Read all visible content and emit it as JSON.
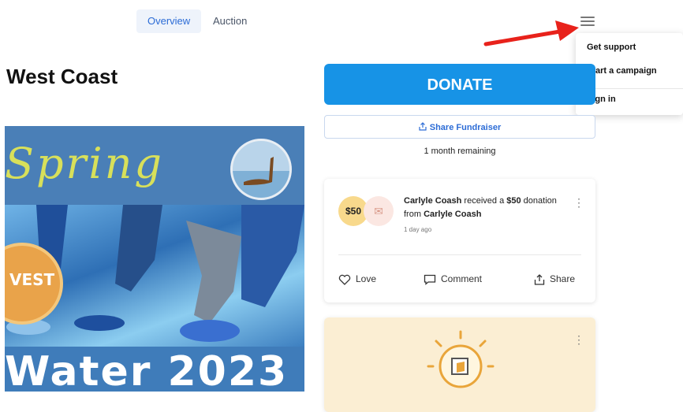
{
  "nav": {
    "tabs": [
      {
        "label": "Overview"
      },
      {
        "label": "Auction"
      }
    ]
  },
  "menu": {
    "items": [
      "Get support",
      "Start a campaign",
      "Sign in"
    ]
  },
  "campaign": {
    "title": "West Coast"
  },
  "poster": {
    "top_text": "Spring",
    "badge_text": "VEST",
    "bottom_text": "Water 2023"
  },
  "donate": {
    "label": "DONATE",
    "share_label": "Share Fundraiser",
    "remaining": "1 month remaining"
  },
  "activity": {
    "amount": "$50",
    "donor": "Carlyle Coash",
    "text_mid": " received a ",
    "amount_text": "$50",
    "text_after": " donation from ",
    "from": "Carlyle Coash",
    "time": "1 day ago",
    "actions": [
      "Love",
      "Comment",
      "Share"
    ]
  },
  "colors": {
    "accent": "#1793e6",
    "link": "#2c6cd6",
    "arrow": "#e8221b"
  },
  "icons": [
    "hamburger-icon",
    "share-icon",
    "heart-icon",
    "comment-icon",
    "kebab-icon",
    "gift-icon",
    "sun-icon"
  ]
}
